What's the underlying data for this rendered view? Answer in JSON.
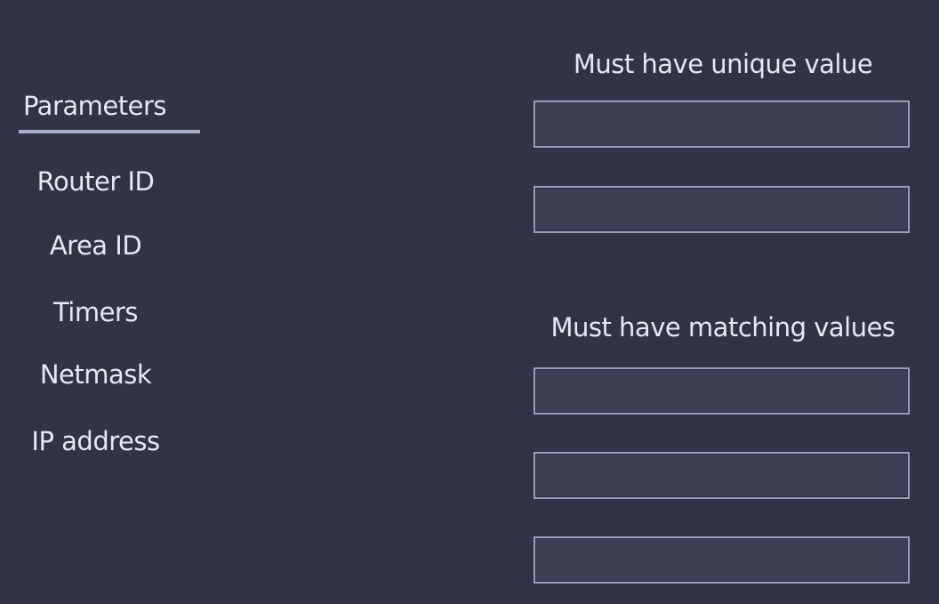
{
  "parameters": {
    "header": "Parameters",
    "items": [
      {
        "label": "Router ID"
      },
      {
        "label": "Area ID"
      },
      {
        "label": "Timers"
      },
      {
        "label": "Netmask"
      },
      {
        "label": "IP address"
      }
    ]
  },
  "targets": {
    "unique": {
      "title": "Must have unique value",
      "slots": 2
    },
    "matching": {
      "title": "Must have matching values",
      "slots": 3
    }
  },
  "colors": {
    "background": "#313346",
    "box_fill": "#3c3f53",
    "box_border": "#9a9fbe",
    "text": "#e6e8f2"
  }
}
